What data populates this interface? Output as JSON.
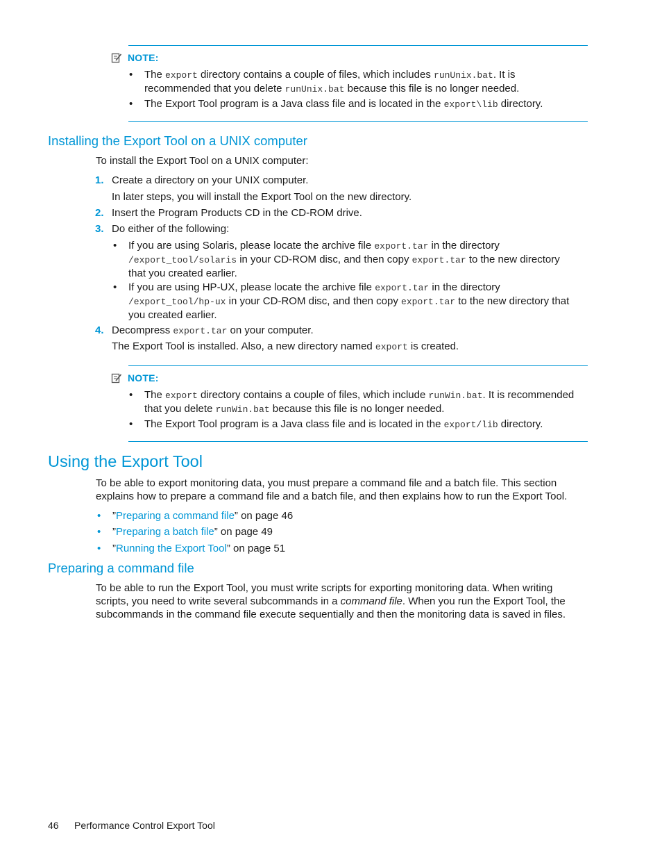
{
  "note1": {
    "label": "NOTE:",
    "b1": {
      "t1": "The ",
      "c1": "export",
      "t2": " directory contains a couple of files, which includes ",
      "c2": "runUnix.bat",
      "t3": ". It is",
      "t4": "recommended that you delete ",
      "c3": "runUnix.bat",
      "t5": " because this file is no longer needed."
    },
    "b2": {
      "t1": "The Export Tool program is a Java class file and is located in the ",
      "c1": "export\\lib",
      "t2": " directory."
    }
  },
  "unix_section": {
    "heading": "Installing the Export Tool on a UNIX computer",
    "intro": "To install the Export Tool on a UNIX computer:",
    "steps": [
      {
        "num": "1.",
        "text": "Create a directory on your UNIX computer.",
        "sub": "In later steps, you will install the Export Tool on the new directory."
      },
      {
        "num": "2.",
        "text": "Insert the Program Products CD in the CD-ROM drive."
      },
      {
        "num": "3.",
        "text": "Do either of the following:"
      },
      {
        "num": "4.",
        "t1": "Decompress ",
        "c1": "export.tar",
        "t2": " on your computer.",
        "sub_t1": "The Export Tool is installed. Also, a new directory named ",
        "sub_c1": "export",
        "sub_t2": " is created."
      }
    ],
    "solaris": {
      "t1": "If you are using Solaris, please locate the archive file ",
      "c1": "export.tar",
      "t2": " in the directory",
      "c2": "/export_tool/solaris",
      "t3": " in your CD-ROM disc, and then copy ",
      "c3": "export.tar",
      "t4": " to the new directory",
      "t5": "that you created earlier."
    },
    "hpux": {
      "t1": "If you are using HP-UX, please locate the archive file ",
      "c1": "export.tar",
      "t2": " in the directory",
      "c2": "/export_tool/hp-ux",
      "t3": " in your CD-ROM disc, and then copy ",
      "c3": "export.tar",
      "t4": " to the new directory that",
      "t5": "you created earlier."
    }
  },
  "note2": {
    "label": "NOTE:",
    "b1": {
      "t1": "The ",
      "c1": "export",
      "t2": " directory contains a couple of files, which include ",
      "c2": "runWin.bat",
      "t3": ". It is recommended",
      "t4": "that you delete ",
      "c3": "runWin.bat",
      "t5": " because this file is no longer needed."
    },
    "b2": {
      "t1": "The Export Tool program is a Java class file and is located in the ",
      "c1": "export/lib",
      "t2": " directory."
    }
  },
  "using_section": {
    "heading": "Using the Export Tool",
    "p1": "To be able to export monitoring data, you must prepare a command file and a batch file. This section",
    "p2": "explains how to prepare a command file and a batch file, and then explains how to run the Export Tool.",
    "links": [
      {
        "open": "”",
        "label": "Preparing a command file",
        "close": "” on page 46"
      },
      {
        "open": "”",
        "label": "Preparing a batch file",
        "close": "” on page 49"
      },
      {
        "open": "”",
        "label": "Running the Export Tool",
        "close": "” on page 51"
      }
    ]
  },
  "command_section": {
    "heading": "Preparing a command file",
    "l1": "To be able to run the Export Tool, you must write scripts for exporting monitoring data. When writing",
    "l2a": "scripts, you need to write several subcommands in a ",
    "l2em": "command file",
    "l2b": ". When you run the Export Tool, the",
    "l3": "subcommands in the command file execute sequentially and then the monitoring data is saved in files."
  },
  "footer": {
    "page_number": "46",
    "title": "Performance Control Export Tool"
  },
  "colors": {
    "accent": "#0096d6",
    "text": "#1a1a1a"
  },
  "bullet_glyph": "•"
}
